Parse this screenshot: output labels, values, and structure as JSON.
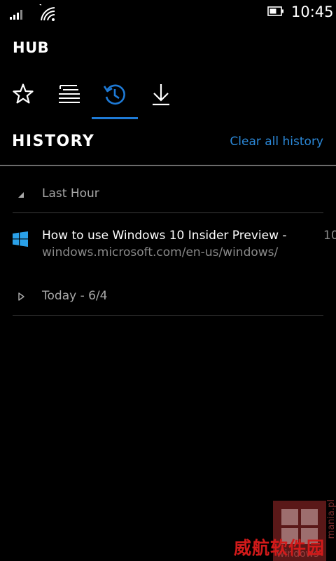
{
  "status": {
    "time": "10:45"
  },
  "hub": {
    "title": "HUB"
  },
  "pivots": [
    {
      "name": "favorites",
      "icon": "star-icon",
      "active": false
    },
    {
      "name": "reading-list",
      "icon": "reading-list-icon",
      "active": false
    },
    {
      "name": "history",
      "icon": "history-icon",
      "active": true
    },
    {
      "name": "downloads",
      "icon": "download-icon",
      "active": false
    }
  ],
  "history": {
    "title": "HISTORY",
    "clear_label": "Clear all history",
    "groups": [
      {
        "label": "Last Hour",
        "expanded": true
      },
      {
        "label": "Today - 6/4",
        "expanded": false
      }
    ],
    "items": [
      {
        "title": "How to use Windows 10 Insider Preview -",
        "url": "windows.microsoft.com/en-us/windows/",
        "time": "10"
      }
    ]
  },
  "watermark": {
    "cn": "威航软件园",
    "side": "mania.pl",
    "bottom": "windows"
  },
  "colors": {
    "accent": "#1e7ad6",
    "link": "#2b88d8",
    "windows_logo": "#2aa0e8"
  }
}
